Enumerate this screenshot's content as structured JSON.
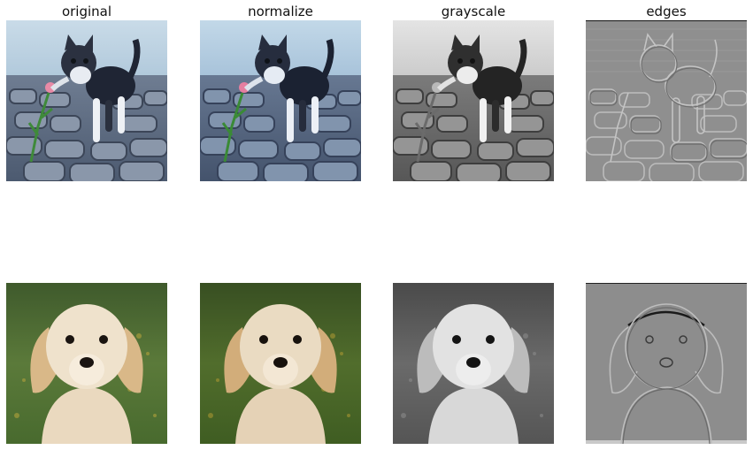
{
  "columns": [
    {
      "key": "original",
      "title": "original"
    },
    {
      "key": "normalize",
      "title": "normalize"
    },
    {
      "key": "grayscale",
      "title": "grayscale"
    },
    {
      "key": "edges",
      "title": "edges"
    }
  ],
  "rows": [
    {
      "subject": "kitten"
    },
    {
      "subject": "puppy"
    }
  ]
}
